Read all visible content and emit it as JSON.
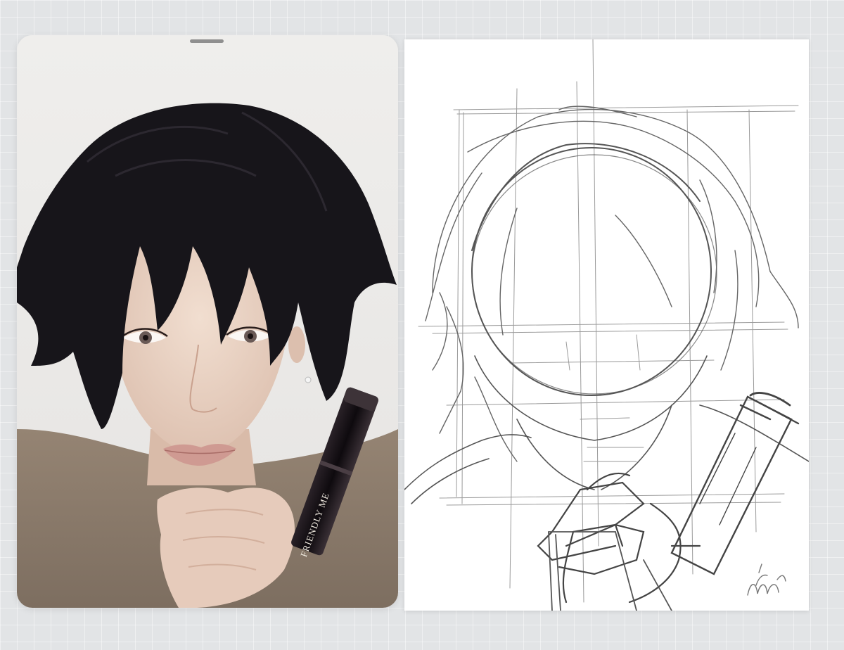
{
  "reference": {
    "product_label": "FRIENDLY ME"
  },
  "colors": {
    "background": "#e2e4e6",
    "hair": "#17151a",
    "sweater": "#8b7b6b",
    "skin": "#e9d3c3",
    "lipstick": "#141014",
    "pencil": "#555555"
  },
  "icons": {
    "panel_handle": "drag-handle-icon",
    "signature": "artist-signature"
  }
}
